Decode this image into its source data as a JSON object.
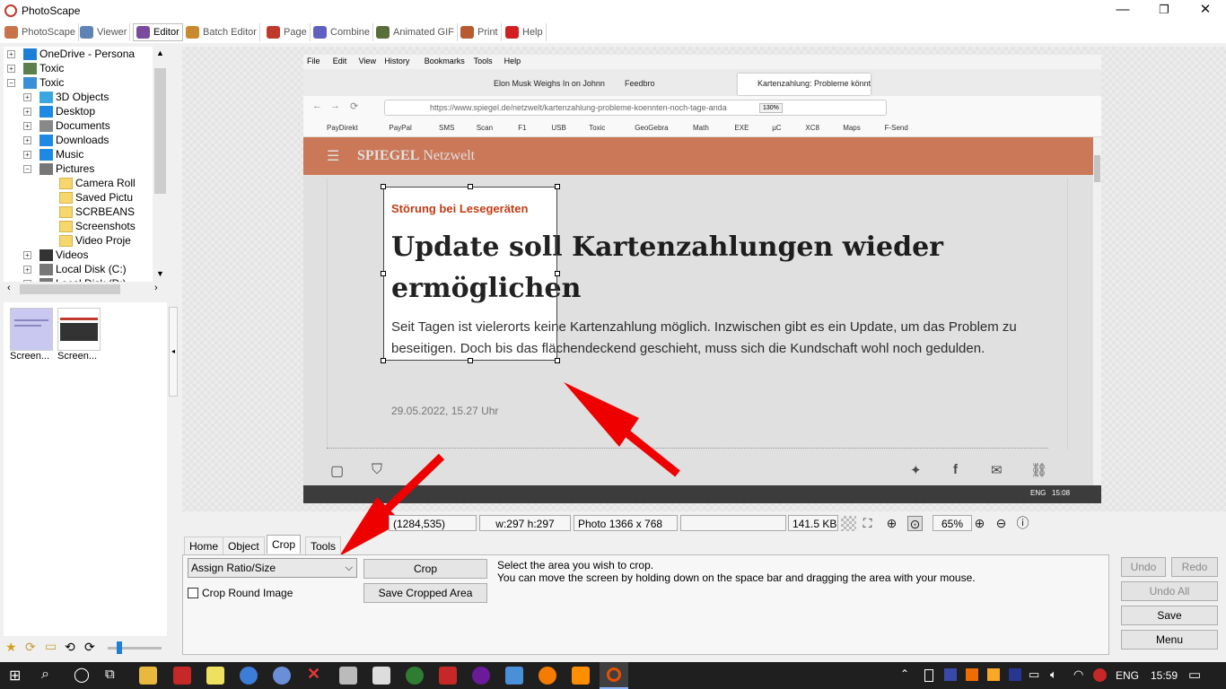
{
  "window": {
    "title": "PhotoScape",
    "minimize": "—",
    "maximize": "❐",
    "close": "✕"
  },
  "menu_tabs": [
    {
      "label": "PhotoScape",
      "color": "#c8734a"
    },
    {
      "label": "Viewer",
      "color": "#5e84b7"
    },
    {
      "label": "Editor",
      "color": "#7a4a9c",
      "active": true
    },
    {
      "label": "Batch Editor",
      "color": "#c98a2d"
    },
    {
      "label": "Page",
      "color": "#c0392b"
    },
    {
      "label": "Combine",
      "color": "#6060c0"
    },
    {
      "label": "Animated GIF",
      "color": "#5a6e3a"
    },
    {
      "label": "Print",
      "color": "#b85a30"
    },
    {
      "label": "Help",
      "color": "#d02020"
    }
  ],
  "tree": [
    {
      "label": "OneDrive - Persona",
      "level": 0,
      "icon": "cloud-icon",
      "color": "#1e7fd6"
    },
    {
      "label": "Toxic",
      "level": 0,
      "icon": "user-icon",
      "color": "#5b7f4a"
    },
    {
      "label": "Toxic",
      "level": 0,
      "icon": "computer-icon",
      "color": "#3a8fd6",
      "expanded": true
    },
    {
      "label": "3D Objects",
      "level": 1,
      "icon": "cube-icon",
      "color": "#3aa7e0"
    },
    {
      "label": "Desktop",
      "level": 1,
      "icon": "desktop-icon",
      "color": "#1e88e5"
    },
    {
      "label": "Documents",
      "level": 1,
      "icon": "document-icon",
      "color": "#888"
    },
    {
      "label": "Downloads",
      "level": 1,
      "icon": "download-icon",
      "color": "#1e88e5"
    },
    {
      "label": "Music",
      "level": 1,
      "icon": "music-icon",
      "color": "#1e88e5"
    },
    {
      "label": "Pictures",
      "level": 1,
      "icon": "pictures-icon",
      "color": "#777",
      "expanded": true
    },
    {
      "label": "Camera Roll",
      "level": 2,
      "icon": "folder-icon",
      "color": "#f5d76e"
    },
    {
      "label": "Saved Pictu",
      "level": 2,
      "icon": "folder-icon",
      "color": "#f5d76e"
    },
    {
      "label": "SCRBEANS",
      "level": 2,
      "icon": "folder-icon",
      "color": "#f5d76e"
    },
    {
      "label": "Screenshots",
      "level": 2,
      "icon": "folder-icon",
      "color": "#f5d76e"
    },
    {
      "label": "Video Proje",
      "level": 2,
      "icon": "folder-icon",
      "color": "#f5d76e"
    },
    {
      "label": "Videos",
      "level": 1,
      "icon": "video-icon",
      "color": "#333"
    },
    {
      "label": "Local Disk (C:)",
      "level": 1,
      "icon": "disk-icon",
      "color": "#777"
    },
    {
      "label": "Local Disk (D:)",
      "level": 1,
      "icon": "disk-icon",
      "color": "#777"
    }
  ],
  "thumbnails": [
    {
      "label": "Screen..."
    },
    {
      "label": "Screen..."
    }
  ],
  "image": {
    "ff_menu": [
      "File",
      "Edit",
      "View",
      "History",
      "Bookmarks",
      "Tools",
      "Help"
    ],
    "ff_tabs": [
      "Elon Musk Weighs In on Johnny",
      "Feedbro",
      "Kartenzahlung: Probleme könnt"
    ],
    "ff_url": "https://www.spiegel.de/netzwelt/kartenzahlung-probleme-koennten-noch-tage-anda",
    "ff_zoom": "130%",
    "ff_bookmarks": [
      "PayDirekt",
      "PayPal",
      "SMS",
      "Scan",
      "F1",
      "USB",
      "Toxic",
      "GeoGebra",
      "Math",
      "EXE",
      "µC",
      "XC8",
      "Maps",
      "F-Send"
    ],
    "site_logo_bold": "SPIEGEL",
    "site_logo_rest": " Netzwelt",
    "kicker": "Störung bei Lesegeräten",
    "headline": "Update soll Kartenzahlungen wieder ermöglichen",
    "lead": "Seit Tagen ist vielerorts keine Kartenzahlung möglich. Inzwischen gibt es ein Update, um das Problem zu beseitigen. Doch bis das flächendeckend geschieht, muss sich die Kundschaft wohl noch gedulden.",
    "date": "29.05.2022, 15.27 Uhr",
    "taskbar_lang": "ENG",
    "taskbar_time": "15:08"
  },
  "status": {
    "coords": "(1284,535)",
    "size": "w:297 h:297",
    "photo": "Photo 1366 x 768",
    "filesize": "141.5 KB",
    "zoom": "65%"
  },
  "editor_tabs": [
    "Home",
    "Object",
    "Crop",
    "Tools"
  ],
  "active_editor_tab": "Crop",
  "crop": {
    "ratio_select": "Assign Ratio/Size",
    "crop_button": "Crop",
    "save_cropped_button": "Save Cropped Area",
    "round_label": "Crop Round Image",
    "hint_line1": "Select the area you wish to crop.",
    "hint_line2": "You can move the screen by holding down on the space bar and dragging the area with your mouse."
  },
  "right_buttons": {
    "undo": "Undo",
    "redo": "Redo",
    "undo_all": "Undo All",
    "save": "Save",
    "menu": "Menu"
  },
  "taskbar": {
    "lang": "ENG",
    "time": "15:59"
  },
  "colors": {
    "annotation_arrow": "#ee0000",
    "spiegel": "#e88966",
    "kicker": "#c23b14"
  }
}
